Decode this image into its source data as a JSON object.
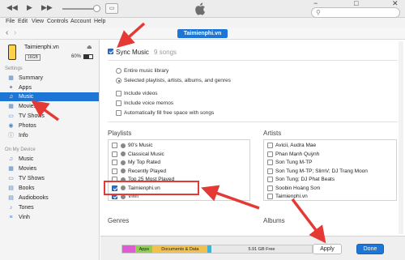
{
  "toolbar": {
    "prev_icon": "◀◀",
    "play_icon": "▶",
    "next_icon": "▶▶",
    "airplay_icon": "▭",
    "win_min": "−",
    "win_max": "□",
    "win_close": "✕",
    "search_placeholder": "",
    "search_icon": "⚲"
  },
  "menubar": {
    "items": [
      "File",
      "Edit",
      "View",
      "Controls",
      "Account",
      "Help"
    ]
  },
  "navigation": {
    "back": "‹",
    "forward": "›",
    "device_tab": "Taimienphi.vn"
  },
  "device": {
    "name": "Taimienphi.vn",
    "eject": "⏏",
    "capacity": "16GB",
    "battery": "60%",
    "battery_level": 0.6
  },
  "sidebar": {
    "settings_header": "Settings",
    "settings_items": [
      {
        "label": "Summary",
        "icon": "▦"
      },
      {
        "label": "Apps",
        "icon": "✦"
      },
      {
        "label": "Music",
        "icon": "♫"
      },
      {
        "label": "Movies",
        "icon": "▦"
      },
      {
        "label": "TV Shows",
        "icon": "▭"
      },
      {
        "label": "Photos",
        "icon": "◉"
      },
      {
        "label": "Info",
        "icon": "ⓘ"
      }
    ],
    "on_device_header": "On My Device",
    "device_items": [
      {
        "label": "Music",
        "icon": "♫"
      },
      {
        "label": "Movies",
        "icon": "▦"
      },
      {
        "label": "TV Shows",
        "icon": "▭"
      },
      {
        "label": "Books",
        "icon": "▤"
      },
      {
        "label": "Audiobooks",
        "icon": "▤"
      },
      {
        "label": "Tones",
        "icon": "♪"
      },
      {
        "label": "Vinh",
        "icon": "≡"
      }
    ]
  },
  "sync": {
    "label": "Sync Music",
    "count": "9 songs",
    "options": [
      {
        "type": "radio",
        "label": "Entire music library",
        "on": false
      },
      {
        "type": "radio",
        "label": "Selected playlists, artists, albums, and genres",
        "on": true
      },
      {
        "type": "checkbox",
        "label": "Include videos",
        "on": false
      },
      {
        "type": "checkbox",
        "label": "Include voice memos",
        "on": false
      },
      {
        "type": "checkbox",
        "label": "Automatically fill free space with songs",
        "on": false
      }
    ]
  },
  "playlists": {
    "header": "Playlists",
    "items": [
      {
        "label": "90's Music",
        "checked": false
      },
      {
        "label": "Classical Music",
        "checked": false
      },
      {
        "label": "My Top Rated",
        "checked": false
      },
      {
        "label": "Recently Played",
        "checked": false
      },
      {
        "label": "Top 25 Most Played",
        "checked": false
      },
      {
        "label": "Taimienphi.vn",
        "checked": true
      },
      {
        "label": "Vinh",
        "checked": true
      }
    ]
  },
  "artists": {
    "header": "Artists",
    "items": [
      {
        "label": "Avicii, Audra Mae"
      },
      {
        "label": "Phan Mạnh Quỳnh"
      },
      {
        "label": "Son Tung M-TP"
      },
      {
        "label": "Son Tung M-TP; SlimV; DJ Trang Moon"
      },
      {
        "label": "Son Tung; DJ Phat Beats"
      },
      {
        "label": "Soobin Hoàng Sơn"
      },
      {
        "label": "Taimienphi.vn"
      }
    ]
  },
  "genres": {
    "header": "Genres"
  },
  "albums": {
    "header": "Albums"
  },
  "storage": {
    "segments": [
      {
        "label": "",
        "color": "#e05bd3",
        "fraction": 0.07
      },
      {
        "label": "Apps",
        "color": "#8fd14f",
        "fraction": 0.09
      },
      {
        "label": "Documents & Data",
        "color": "#f2c14b",
        "fraction": 0.29
      },
      {
        "label": "",
        "color": "#3db4d8",
        "fraction": 0.02
      },
      {
        "label": "5.91 GB Free",
        "color": "#e8e8e8",
        "fraction": 0.53
      }
    ]
  },
  "buttons": {
    "apply": "Apply",
    "done": "Done"
  },
  "colors": {
    "accent": "#1d76d6",
    "annotation": "#e53935"
  }
}
